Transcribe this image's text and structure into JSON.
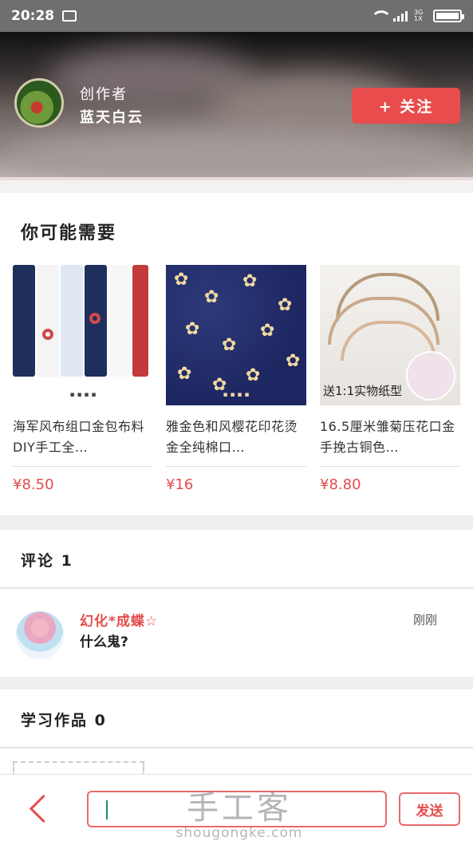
{
  "status_bar": {
    "time": "20:28",
    "network": "3G 1X"
  },
  "author": {
    "role": "创作者",
    "name": "蓝天白云",
    "follow_label": "+ 关注"
  },
  "recommend": {
    "title": "你可能需要",
    "products": [
      {
        "title": "海军风布组口金包布料DIY手工全…",
        "price": "¥8.50"
      },
      {
        "title": "雅金色和风樱花印花烫金全纯棉口…",
        "price": "¥16"
      },
      {
        "title": "16.5厘米雏菊压花口金手挽古铜色…",
        "price": "¥8.80",
        "image_tag": "送1:1实物纸型"
      }
    ]
  },
  "comments": {
    "title": "评论 1",
    "items": [
      {
        "user": "幻化*成蝶☆",
        "text": "什么鬼?",
        "time": "刚刚"
      }
    ]
  },
  "works": {
    "title": "学习作品 0"
  },
  "bottom_bar": {
    "send_label": "发送"
  },
  "watermark": {
    "cn": "手工客",
    "domain": "shougongke.com"
  },
  "colors": {
    "accent": "#e84c4c",
    "price": "#e44c4c"
  }
}
